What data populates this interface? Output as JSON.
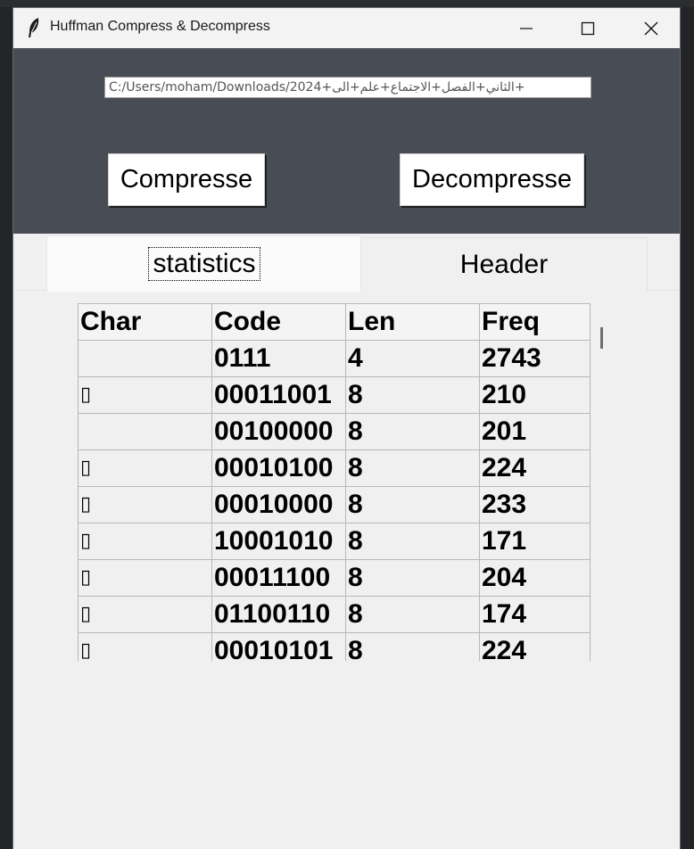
{
  "window": {
    "title": "Huffman Compress & Decompress"
  },
  "titlebar_icons": [
    "feather-icon",
    "minimize-icon",
    "maximize-icon",
    "close-icon"
  ],
  "top_panel": {
    "path_value": "C:/Users/moham/Downloads/2024+الثاني+الفصل+الاجتماع+علم+الى+",
    "compress_label": "Compresse",
    "decompress_label": "Decompresse"
  },
  "tabs": [
    {
      "label": "statistics",
      "selected": true
    },
    {
      "label": "Header",
      "selected": false
    }
  ],
  "table": {
    "headers": [
      "Char",
      "Code",
      "Len",
      "Freq"
    ],
    "rows": [
      {
        "char": "",
        "code": "0111",
        "len": "4",
        "freq": "2743"
      },
      {
        "char": "▯",
        "code": "00011001",
        "len": "8",
        "freq": "210"
      },
      {
        "char": "",
        "code": "00100000",
        "len": "8",
        "freq": "201"
      },
      {
        "char": "▯",
        "code": "00010100",
        "len": "8",
        "freq": "224"
      },
      {
        "char": "▯",
        "code": "00010000",
        "len": "8",
        "freq": "233"
      },
      {
        "char": "▯",
        "code": "10001010",
        "len": "8",
        "freq": "171"
      },
      {
        "char": "▯",
        "code": "00011100",
        "len": "8",
        "freq": "204"
      },
      {
        "char": "▯",
        "code": "01100110",
        "len": "8",
        "freq": "174"
      },
      {
        "char": "▯",
        "code": "00010101",
        "len": "8",
        "freq": "224"
      }
    ]
  },
  "colors": {
    "top_panel_bg": "#484d55",
    "window_bg": "#f0f0f0"
  }
}
